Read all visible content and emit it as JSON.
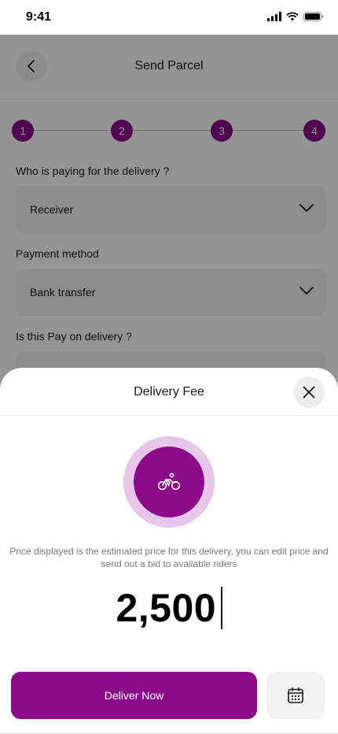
{
  "status_bar": {
    "time": "9:41"
  },
  "header": {
    "title": "Send Parcel"
  },
  "stepper": {
    "steps": [
      "1",
      "2",
      "3",
      "4"
    ]
  },
  "form": {
    "payer_label": "Who is paying for the delivery ?",
    "payer_value": "Receiver",
    "payment_label": "Payment method",
    "payment_value": "Bank transfer",
    "pod_label": "Is this Pay on delivery ?"
  },
  "sheet": {
    "title": "Delivery Fee",
    "info": "Price displayed is the estimated price for this delivery, you can edit price and send out a bid to available riders",
    "price": "2,500",
    "deliver_label": "Deliver Now"
  },
  "colors": {
    "brand": "#8b0a8a",
    "brand_light": "#e6c7ea"
  },
  "icons": [
    "back-arrow-icon",
    "chevron-down-icon",
    "close-icon",
    "bicycle-icon",
    "calendar-icon",
    "signal-icon",
    "wifi-icon",
    "battery-icon"
  ]
}
